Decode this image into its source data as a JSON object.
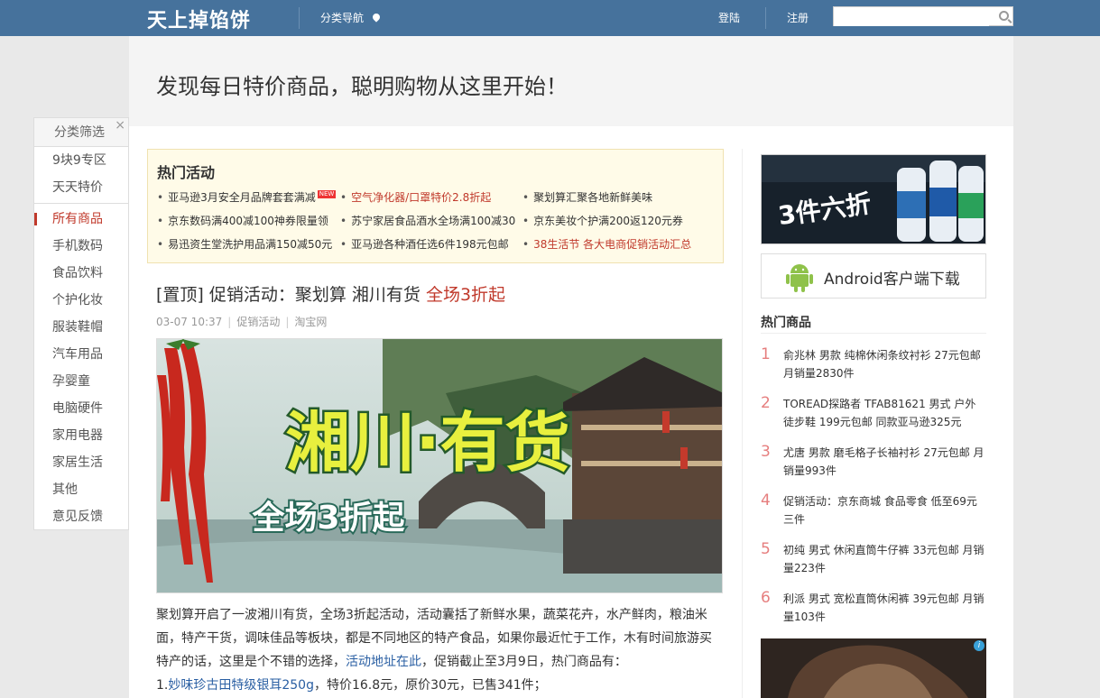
{
  "header": {
    "logo": "天上掉馅饼",
    "nav_category": "分类导航",
    "login": "登陆",
    "register": "注册",
    "search_placeholder": ""
  },
  "banner": {
    "slogan": "发现每日特价商品，聪明购物从这里开始！"
  },
  "sidebar": {
    "title": "分类筛选",
    "close": "×",
    "items_top": [
      "9块9专区",
      "天天特价"
    ],
    "items": [
      "所有商品",
      "手机数码",
      "食品饮料",
      "个护化妆",
      "服装鞋帽",
      "汽车用品",
      "孕婴童",
      "电脑硬件",
      "家用电器",
      "家居生活",
      "其他",
      "意见反馈"
    ],
    "active_index": 0
  },
  "hot_activity": {
    "title": "热门活动",
    "new_badge": "NEW",
    "items": [
      "亚马逊3月安全月品牌套套满减",
      "空气净化器/口罩特价2.8折起",
      "聚划算汇聚各地新鲜美味",
      "京东数码满400减100神券限量领",
      "苏宁家居食品酒水全场满100减30",
      "京东美妆个护满200返120元券",
      "易迅资生堂洗护用品满150减50元",
      "亚马逊各种酒任选6件198元包邮",
      "38生活节 各大电商促销活动汇总"
    ]
  },
  "article": {
    "title_prefix": "[置顶] 促销活动：聚划算 湘川有货",
    "title_highlight": "全场3折起",
    "date": "03-07 10:37",
    "category": "促销活动",
    "source": "淘宝网",
    "image_title": "湘川·有货",
    "image_subtitle": "全场3折起",
    "body_1": "聚划算开启了一波湘川有货，全场3折起活动，活动囊括了新鲜水果，蔬菜花卉，水产鲜肉，粮油米面，特产干货，调味佳品等板块，都是不同地区的特产食品，如果你最近忙于工作，木有时间旅游买特产的话，这里是个不错的选择，",
    "body_link": "活动地址在此",
    "body_2": "，促销截止至3月9日，热门商品有：",
    "item1_num": "1.",
    "item1_link": "妙味珍古田特级银耳250g",
    "item1_rest": "，特价16.8元，原价30元，已售341件；"
  },
  "right": {
    "promo_text": "3件六折",
    "android_label": "Android客户端下载",
    "hot_goods_title": "热门商品",
    "goods": [
      {
        "rank": "1",
        "text": "俞兆林 男款 纯棉休闲条纹衬衫 27元包邮 月销量2830件"
      },
      {
        "rank": "2",
        "text": "TOREAD探路者 TFAB81621 男式 户外徒步鞋 199元包邮 同款亚马逊325元"
      },
      {
        "rank": "3",
        "text": "尤唐 男款 磨毛格子长袖衬衫 27元包邮 月销量993件"
      },
      {
        "rank": "4",
        "text": "促销活动：京东商城 食品零食 低至69元三件"
      },
      {
        "rank": "5",
        "text": "初纯 男式 休闲直筒牛仔裤 33元包邮 月销量223件"
      },
      {
        "rank": "6",
        "text": "利派 男式 宽松直筒休闲裤 39元包邮 月销量103件"
      }
    ],
    "ad_info": "i"
  },
  "colors": {
    "topbar": "#46729c",
    "accent_red": "#c0392b",
    "link_blue": "#2a5fa3"
  }
}
